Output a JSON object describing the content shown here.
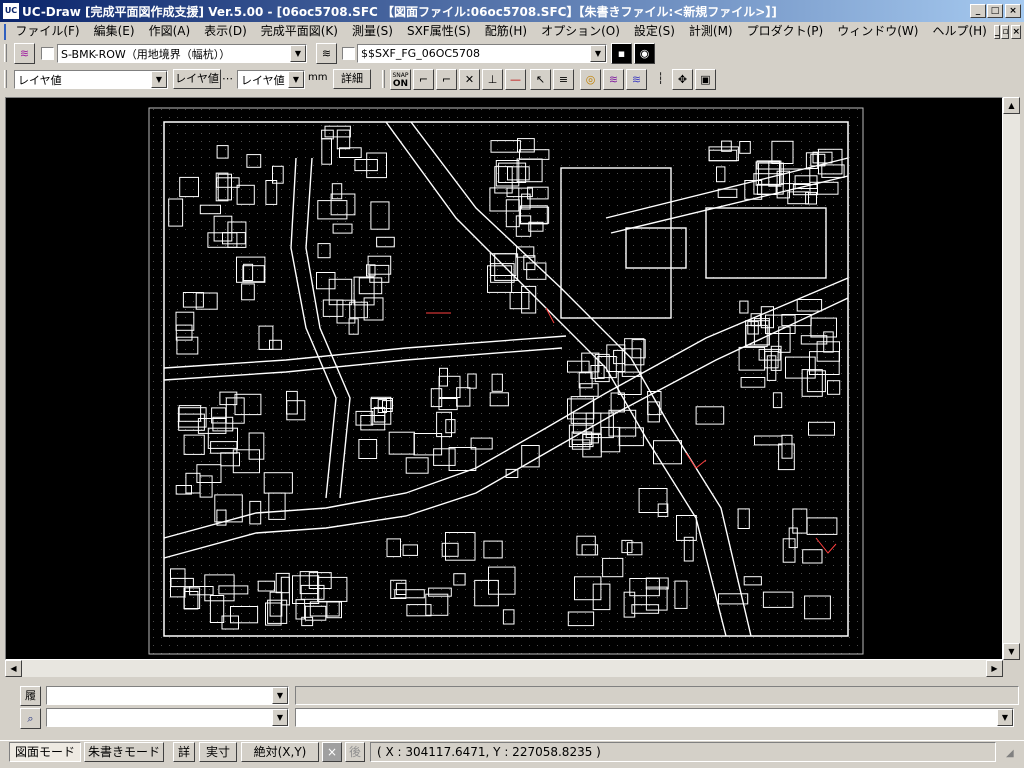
{
  "window": {
    "title": "UC-Draw [完成平面図作成支援] Ver.5.00 - [06oc5708.SFC 【図面ファイル:06oc5708.SFC】【朱書きファイル:<新規ファイル>】]",
    "app_icon_label": "UC"
  },
  "menu": {
    "items": [
      "ファイル(F)",
      "編集(E)",
      "作図(A)",
      "表示(D)",
      "完成平面図(K)",
      "測量(S)",
      "SXF属性(S)",
      "配筋(H)",
      "オプション(O)",
      "設定(S)",
      "計測(M)",
      "プロダクト(P)",
      "ウィンドウ(W)",
      "ヘルプ(H)"
    ]
  },
  "toolbar1": {
    "layer_combo_value": "S-BMK-ROW（用地境界（幅杭））",
    "sxf_combo_value": "$$SXF_FG_06OC5708"
  },
  "toolbar2": {
    "layer_value_1": "レイヤ値",
    "layer_value_2": "レイヤ値",
    "layer_value_3": "レイヤ値",
    "unit": "mm",
    "detail_button": "詳細",
    "snap_label_top": "SNAP",
    "snap_label_bottom": "ON"
  },
  "command": {
    "history_label": "履",
    "history_value": "",
    "search_value": "",
    "message": "",
    "input": ""
  },
  "statusbar": {
    "tab_drawing_mode": "図面モード",
    "tab_markup_mode": "朱書きモード",
    "detail": "詳",
    "actual_size": "実寸",
    "absolute": "絶対(X,Y)",
    "x_button": "×",
    "after_button": "後",
    "coordinates": "( X : 304117.6471, Y : 227058.8235 )"
  },
  "colors": {
    "title_gradient_start": "#0a246a",
    "title_gradient_end": "#a6caf0",
    "canvas_bg": "#000000",
    "drawing_line": "#ffffff",
    "markup_red": "#ff4040"
  }
}
